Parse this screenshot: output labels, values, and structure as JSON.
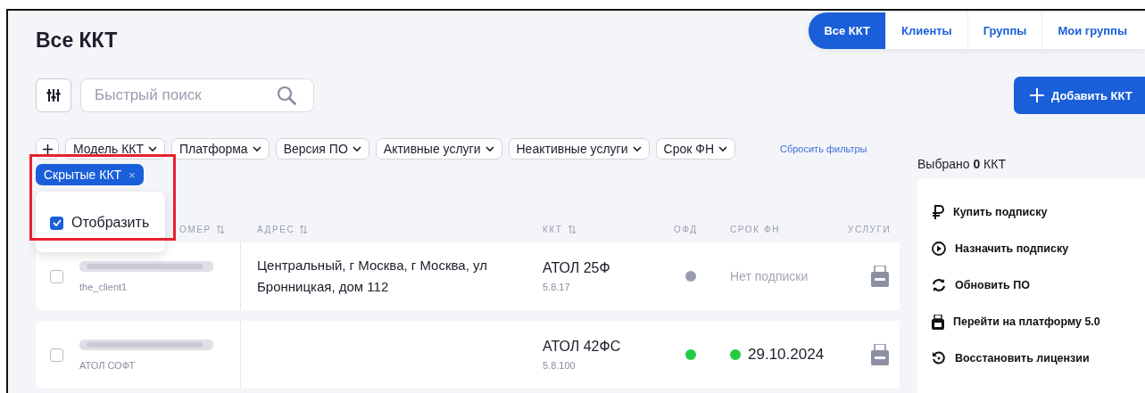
{
  "title": "Все ККТ",
  "tabs": [
    {
      "label": "Все ККТ",
      "selected": true
    },
    {
      "label": "Клиенты",
      "selected": false
    },
    {
      "label": "Группы",
      "selected": false
    },
    {
      "label": "Мои группы",
      "selected": false
    }
  ],
  "search": {
    "placeholder": "Быстрый поиск"
  },
  "add_button": {
    "label": "Добавить ККТ"
  },
  "filters": [
    "Модель ККТ",
    "Платформа",
    "Версия ПО",
    "Активные услуги",
    "Неактивные услуги",
    "Срок ФН"
  ],
  "reset_filters": "Сбросить фильтры",
  "active_filter": {
    "label": "Скрытые ККТ",
    "close": "×"
  },
  "filter_popup": {
    "label": "Отобразить",
    "checked": true
  },
  "table": {
    "columns": [
      {
        "label": "ОМЕР",
        "sortable": true
      },
      {
        "label": "АДРЕС",
        "sortable": true
      },
      {
        "label": "ККТ",
        "sortable": true
      },
      {
        "label": "ОФД",
        "sortable": false
      },
      {
        "label": "СРОК ФН",
        "sortable": false
      },
      {
        "label": "УСЛУГИ",
        "sortable": false
      }
    ],
    "rows": [
      {
        "checked": false,
        "client": "the_client1",
        "address": "Центральный, г Москва, г Москва, ул Бронницкая, дом 112",
        "model": "АТОЛ 25Ф",
        "firmware": "5.8.17",
        "ofd": {
          "color": "#9a9cb0"
        },
        "fn": {
          "kind": "none",
          "text": "Нет подписки"
        }
      },
      {
        "checked": false,
        "client": "АТОЛ СОФТ",
        "model": "АТОЛ 42ФС",
        "firmware": "5.8.100",
        "ofd": {
          "color": "#22cc44"
        },
        "fn": {
          "kind": "date",
          "text": "29.10.2024",
          "color": "#22cc44"
        }
      }
    ]
  },
  "selection": "Выбрано **0** ККТ",
  "actions": [
    {
      "kind": "ruble",
      "label": "Купить подписку"
    },
    {
      "kind": "play",
      "label": "Назначить подписку"
    },
    {
      "kind": "refresh",
      "label": "Обновить ПО"
    },
    {
      "kind": "platform",
      "label": "Перейти на платформу 5.0"
    },
    {
      "kind": "restore",
      "label": "Восстановить лицензии"
    }
  ]
}
